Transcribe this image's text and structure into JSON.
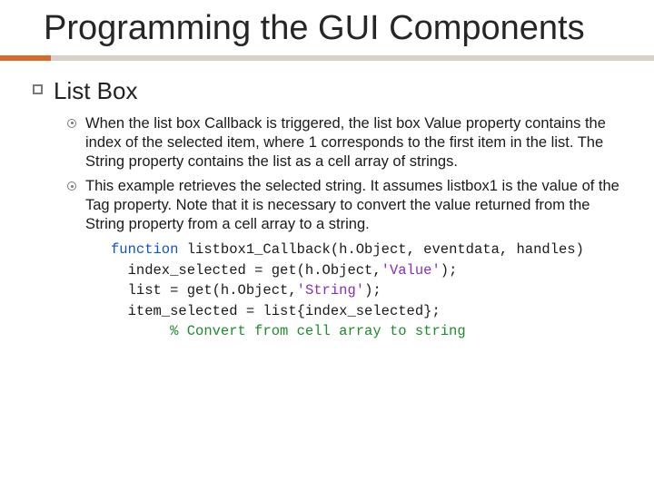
{
  "title": "Programming the GUI Components",
  "section": {
    "heading": "List Box",
    "bullets": [
      "When the list box Callback is triggered, the list box Value property contains the index of the selected item, where 1 corresponds to the first item in the list. The String property contains the list as a cell array of strings.",
      "This example retrieves the selected string. It assumes listbox1 is the value of the Tag property. Note that it is necessary to convert the value returned from the String property from a cell array to a string."
    ]
  },
  "code": {
    "kw_function": "function",
    "sig_rest": " listbox1_Callback(h.Object, eventdata, handles)",
    "line2a": "  index_selected = get(h.Object,",
    "line2str": "'Value'",
    "line2b": ");",
    "line3a": "  list = get(h.Object,",
    "line3str": "'String'",
    "line3b": ");",
    "line4": "  item_selected = list{index_selected};",
    "line5_cmt": "       % Convert from cell array to string"
  },
  "colors": {
    "accent": "#d96b2a",
    "rule": "#d9d2c6"
  }
}
